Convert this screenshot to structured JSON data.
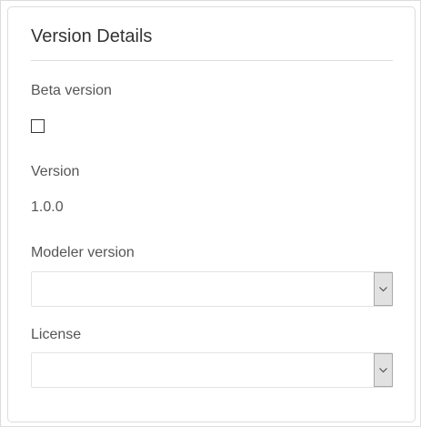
{
  "panel": {
    "title": "Version Details",
    "beta": {
      "label": "Beta version",
      "checked": false
    },
    "version": {
      "label": "Version",
      "value": "1.0.0"
    },
    "modeler_version": {
      "label": "Modeler version",
      "value": ""
    },
    "license": {
      "label": "License",
      "value": ""
    }
  }
}
